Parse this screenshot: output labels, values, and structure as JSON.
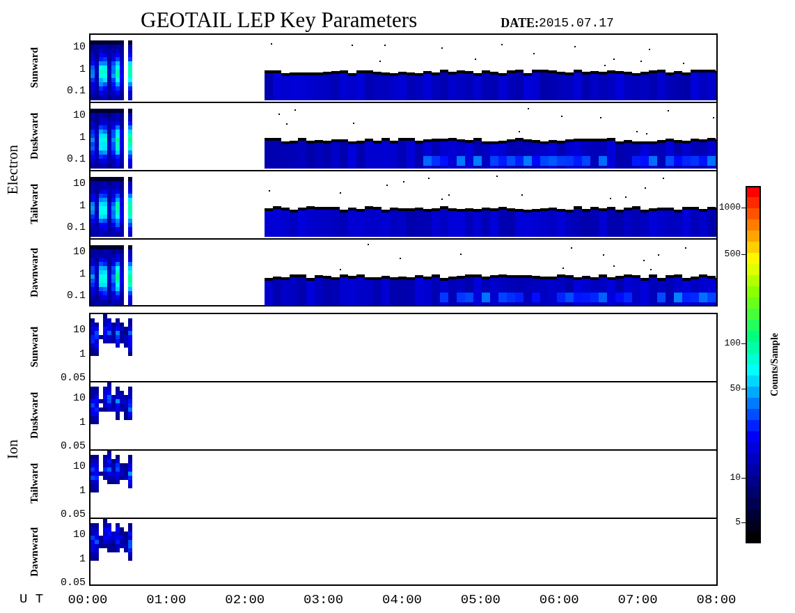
{
  "header": {
    "title": "GEOTAIL LEP Key Parameters",
    "date_label": "DATE:",
    "date": "2015.07.17"
  },
  "groups": [
    {
      "label": "Electron",
      "kind": "electron",
      "panels": [
        {
          "name": "Sunward",
          "ticks": [
            "10",
            "1",
            "0.1"
          ]
        },
        {
          "name": "Duskward",
          "ticks": [
            "10",
            "1",
            "0.1"
          ]
        },
        {
          "name": "Tailward",
          "ticks": [
            "10",
            "1",
            "0.1"
          ]
        },
        {
          "name": "Dawnward",
          "ticks": [
            "10",
            "1",
            "0.1"
          ]
        }
      ]
    },
    {
      "label": "Ion",
      "kind": "ion",
      "panels": [
        {
          "name": "Sunward",
          "ticks": [
            "10",
            "1",
            "0.05"
          ]
        },
        {
          "name": "Duskward",
          "ticks": [
            "10",
            "1",
            "0.05"
          ]
        },
        {
          "name": "Tailward",
          "ticks": [
            "10",
            "1",
            "0.05"
          ]
        },
        {
          "name": "Dawnward",
          "ticks": [
            "10",
            "1",
            "0.05"
          ]
        }
      ]
    }
  ],
  "x_axis": {
    "label": "U T",
    "ticks": [
      "00:00",
      "01:00",
      "02:00",
      "03:00",
      "04:00",
      "05:00",
      "06:00",
      "07:00",
      "08:00"
    ]
  },
  "colorbar": {
    "label": "Counts/Sample",
    "ticks": [
      "1000",
      "500",
      "100",
      "50",
      "10",
      "5"
    ]
  }
}
